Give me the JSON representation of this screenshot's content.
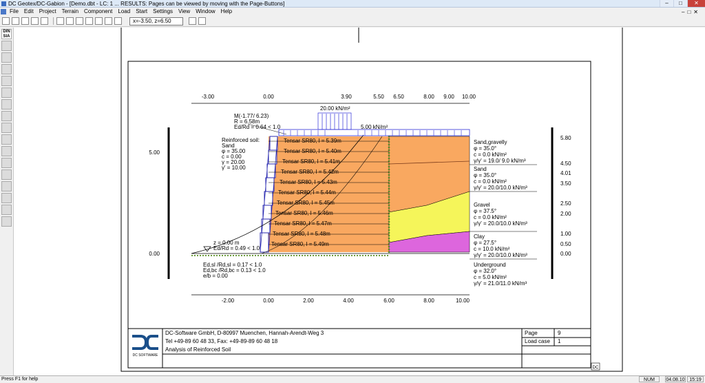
{
  "window": {
    "title": "DC Geotex/DC-Gabion - [Demo.dbt - LC: 1 ... RESULTS: Pages can be viewed by moving with the Page-Buttons]"
  },
  "menu": {
    "items": [
      "File",
      "Edit",
      "Project",
      "Terrain",
      "Component",
      "Load",
      "Start",
      "Settings",
      "View",
      "Window",
      "Help"
    ]
  },
  "toolbar": {
    "coord_readout": "x=-3.50, z=6.50"
  },
  "leftbar": {
    "logo": "DIN SIA"
  },
  "statusbar": {
    "help": "Press F1 for help",
    "num": "NUM",
    "date": "04.08.10",
    "time": "15:19"
  },
  "drawing": {
    "top_axis": [
      "-3.00",
      "0.00",
      "3.90",
      "5.50",
      "6.50",
      "8.00",
      "9.00",
      "10.00"
    ],
    "bottom_axis": [
      "-2.00",
      "0.00",
      "2.00",
      "4.00",
      "6.00",
      "8.00",
      "10.00"
    ],
    "left_axis": [
      "5.00",
      "0.00"
    ],
    "right_axis": [
      "5.80",
      "4.50",
      "4.01",
      "3.50",
      "2.50",
      "2.00",
      "1.00",
      "0.50",
      "0.00"
    ],
    "load_strip": "20.00 kN/m²",
    "load_uniform": "5.00 kN/m²",
    "slip_circle": [
      "M(-1.77/ 6.23)",
      "R =  6.58m",
      "Ed/Rd =  0.64 < 1.0"
    ],
    "reinforced_soil": [
      "Reinforced soil:",
      "Sand",
      "φ  = 35.00",
      "c   = 0.00",
      "γ  = 20.00",
      "γ' = 10.00"
    ],
    "toe": [
      "z =  0.00 m",
      "Ed/Rd =  0.49 < 1.0"
    ],
    "base_checks": [
      "Ed,sl /Rd,sl =  0.17 < 1.0",
      "Ed,bc /Rd,bc =  0.13 < 1.0",
      "e/b = 0.00"
    ],
    "geogrids": [
      "Tensar SR80, l = 5.39m",
      "Tensar SR80, l = 5.40m",
      "Tensar SR80, l = 5.41m",
      "Tensar SR80, l = 5.42m",
      "Tensar SR80, l = 5.43m",
      "Tensar SR80, l = 5.44m",
      "Tensar SR80, l = 5.45m",
      "Tensar SR80, l = 5.46m",
      "Tensar SR80, l = 5.47m",
      "Tensar SR80, l = 5.48m",
      "Tensar SR80, l = 5.49m"
    ],
    "soils": [
      {
        "name": "Sand,gravelly",
        "phi": "φ   =  35.0°",
        "c": "c    =  0.0 kN/m²",
        "gamma": "γ/γ' = 19.0/ 9.0 kN/m³"
      },
      {
        "name": "Sand",
        "phi": "φ   =  35.0°",
        "c": "c    =  0.0 kN/m²",
        "gamma": "γ/γ' = 20.0/10.0 kN/m³"
      },
      {
        "name": "Gravel",
        "phi": "φ   =  37.5°",
        "c": "c    =  0.0 kN/m²",
        "gamma": "γ/γ' = 20.0/10.0 kN/m³"
      },
      {
        "name": "Clay",
        "phi": "φ   =  27.5°",
        "c": "c    = 10.0 kN/m²",
        "gamma": "γ/γ' = 20.0/10.0 kN/m³"
      },
      {
        "name": "Underground",
        "phi": "φ   =  32.0°",
        "c": "c    =  5.0 kN/m²",
        "gamma": "γ/γ' = 21.0/11.0 kN/m³"
      }
    ],
    "colors": {
      "orange": "#f9a860",
      "yellow": "#f5f55a",
      "magenta": "#dd66dd",
      "gabion": "#2a2ab0",
      "load": "#2d2dd8"
    }
  },
  "titleblock": {
    "company": "DC-Software GmbH, D-80997 Muenchen, Hannah-Arendt-Weg 3",
    "phone": "Tel +49-89 60 48 33, Fax: +49-89-89 60 48 18",
    "subject": "Analysis of Reinforced Soil",
    "logo_text": "DC SOFTWARE",
    "page_label": "Page",
    "page_value": "9",
    "loadcase_label": "Load case",
    "loadcase_value": "1",
    "corner_tag": "DC"
  }
}
